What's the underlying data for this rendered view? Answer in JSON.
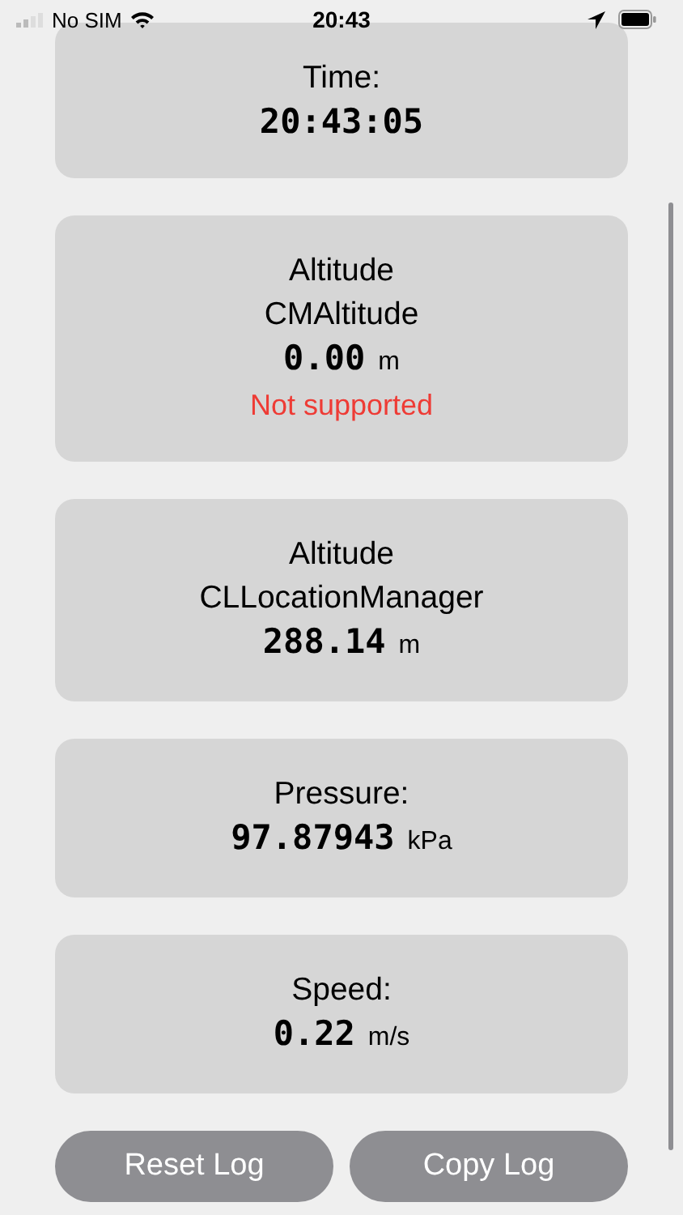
{
  "status_bar": {
    "carrier": "No SIM",
    "time": "20:43"
  },
  "cards": [
    {
      "lines": [
        "Time:"
      ],
      "value": "20:43:05"
    },
    {
      "lines": [
        "Altitude",
        "CMAltitude"
      ],
      "value": "0.00",
      "unit": "m",
      "note": "Not supported"
    },
    {
      "lines": [
        "Altitude",
        "CLLocationManager"
      ],
      "value": "288.14",
      "unit": "m"
    },
    {
      "lines": [
        "Pressure:"
      ],
      "value": "97.87943",
      "unit": "kPa"
    },
    {
      "lines": [
        "Speed:"
      ],
      "value": "0.22",
      "unit": "m/s"
    }
  ],
  "buttons": [
    "Reset Log",
    "Copy Log"
  ]
}
